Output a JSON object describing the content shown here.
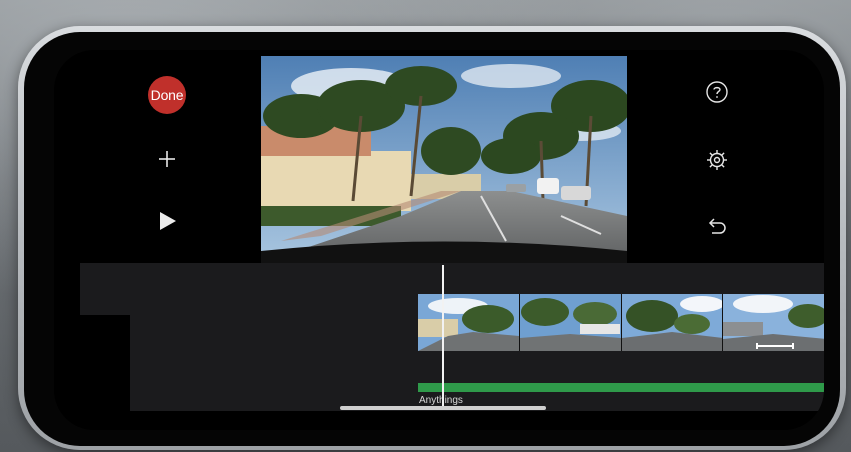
{
  "toolbar": {
    "done_label": "Done",
    "add_icon": "plus-icon",
    "play_icon": "play-icon",
    "help_icon": "question-circle-icon",
    "settings_icon": "gear-icon",
    "undo_icon": "undo-icon"
  },
  "timeline": {
    "audio_track_label": "Anythings"
  },
  "colors": {
    "done_button": "#c0302b",
    "audio_track": "#2f9a4a",
    "timeline_bg": "#1b1b1d"
  }
}
